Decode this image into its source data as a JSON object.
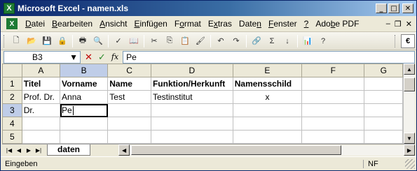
{
  "window": {
    "title": "Microsoft Excel - namen.xls"
  },
  "menu": {
    "items": [
      {
        "pre": "",
        "ul": "D",
        "post": "atei"
      },
      {
        "pre": "",
        "ul": "B",
        "post": "earbeiten"
      },
      {
        "pre": "",
        "ul": "A",
        "post": "nsicht"
      },
      {
        "pre": "",
        "ul": "E",
        "post": "infügen"
      },
      {
        "pre": "F",
        "ul": "o",
        "post": "rmat"
      },
      {
        "pre": "E",
        "ul": "x",
        "post": "tras"
      },
      {
        "pre": "Date",
        "ul": "n",
        "post": ""
      },
      {
        "pre": "",
        "ul": "F",
        "post": "enster"
      },
      {
        "pre": "",
        "ul": "?",
        "post": ""
      },
      {
        "pre": "Ado",
        "ul": "b",
        "post": "e PDF"
      }
    ]
  },
  "formula": {
    "cell_ref": "B3",
    "content": "Pe"
  },
  "grid": {
    "columns": [
      "A",
      "B",
      "C",
      "D",
      "E",
      "F",
      "G"
    ],
    "rows": [
      {
        "num": "1",
        "cells": [
          "Titel",
          "Vorname",
          "Name",
          "Funktion/Herkunft",
          "Namensschild",
          "",
          ""
        ]
      },
      {
        "num": "2",
        "cells": [
          "Prof. Dr.",
          "Anna",
          "Test",
          "Testinstitut",
          "x",
          "",
          ""
        ]
      },
      {
        "num": "3",
        "cells": [
          "Dr.",
          "Pe",
          "",
          "",
          "",
          "",
          ""
        ]
      },
      {
        "num": "4",
        "cells": [
          "",
          "",
          "",
          "",
          "",
          "",
          ""
        ]
      },
      {
        "num": "5",
        "cells": [
          "",
          "",
          "",
          "",
          "",
          "",
          ""
        ]
      }
    ]
  },
  "sheet": {
    "tab": "daten"
  },
  "status": {
    "mode": "Eingeben",
    "indicator": "NF"
  }
}
